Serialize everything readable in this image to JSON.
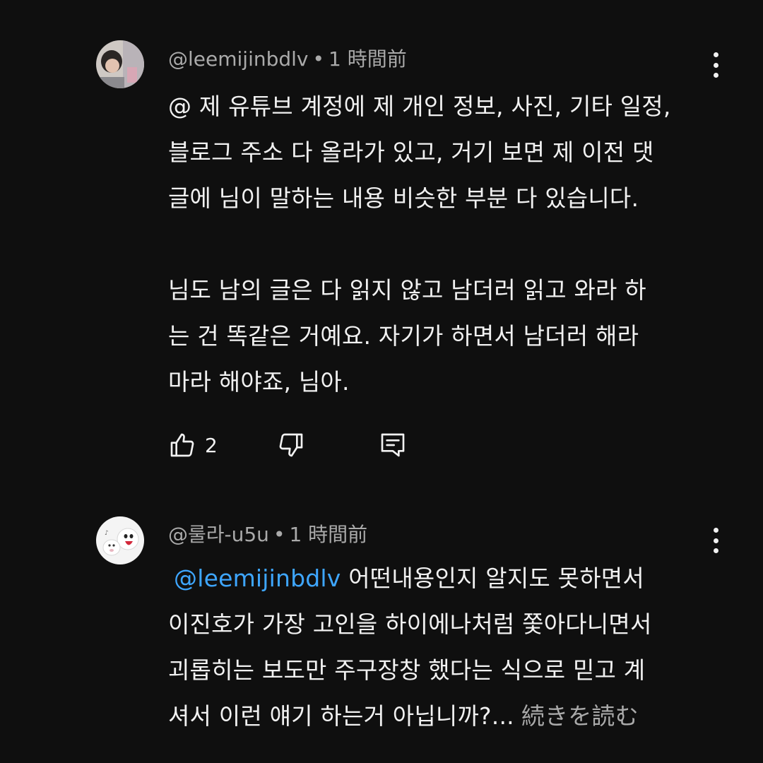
{
  "comments": [
    {
      "author": "@leemijinbdlv",
      "separator": "•",
      "time": "1 時間前",
      "lines": [
        "@ 제 유튜브 계정에 제 개인 정보, 사진, 기타 일정,",
        "블로그 주소 다 올라가 있고, 거기 보면 제 이전 댓",
        "글에 님이 말하는 내용 비슷한 부분 다 있습니다.",
        "",
        "님도 남의 글은 다 읽지 않고 남더러 읽고 와라 하",
        "는 건 똑같은 거예요. 자기가 하면서 남더러 해라",
        "마라 해야죠, 님아."
      ],
      "like_count": "2",
      "icons": {
        "like": "thumbs-up-icon",
        "dislike": "thumbs-down-icon",
        "reply": "reply-icon",
        "menu": "more-vert-icon"
      }
    },
    {
      "author": "@룰라-u5u",
      "separator": "•",
      "time": "1 時間前",
      "mention": "@leemijinbdlv",
      "first_line_rest": " 어떤내용인지 알지도 못하면서",
      "lines": [
        "이진호가 가장 고인을 하이에나처럼 쫓아다니면서",
        "괴롭히는 보도만 주구장창 했다는 식으로 믿고 계",
        "셔서 이런 얘기 하는거 아닙니까?..."
      ],
      "read_more": "続きを読む"
    }
  ],
  "colors": {
    "background": "#0f0f0f",
    "text": "#f1f1f1",
    "secondary": "#aaaaaa",
    "link": "#3ea6ff"
  }
}
